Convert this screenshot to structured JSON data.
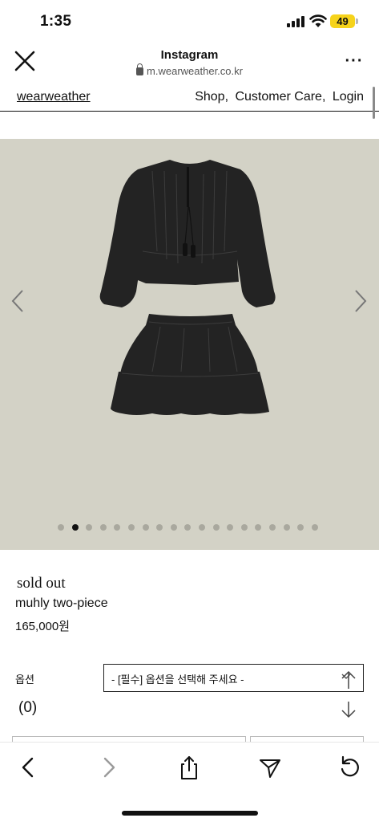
{
  "status_bar": {
    "time": "1:35",
    "battery": "49"
  },
  "browser": {
    "title": "Instagram",
    "url": "m.wearweather.co.kr"
  },
  "site_nav": {
    "logo": "wearweather",
    "links": [
      "Shop,",
      "Customer Care,",
      "Login"
    ]
  },
  "gallery": {
    "total_images": 19,
    "current_index": 2
  },
  "product": {
    "status": "sold out",
    "name": "muhly two-piece",
    "price": "165,000원"
  },
  "options": {
    "label": "옵션",
    "placeholder": "- [필수] 옵션을 선택해 주세요 -",
    "quantity": "(0)"
  },
  "icons": {
    "close": "close-icon",
    "more": "more-icon",
    "prev": "chevron-left-icon",
    "next": "chevron-right-icon",
    "back": "back-icon",
    "forward": "forward-icon",
    "share": "share-icon",
    "send": "send-icon",
    "reload": "reload-icon"
  },
  "colors": {
    "image_background": "#d3d2c6",
    "battery": "#f6d31b",
    "garment": "#232323"
  }
}
